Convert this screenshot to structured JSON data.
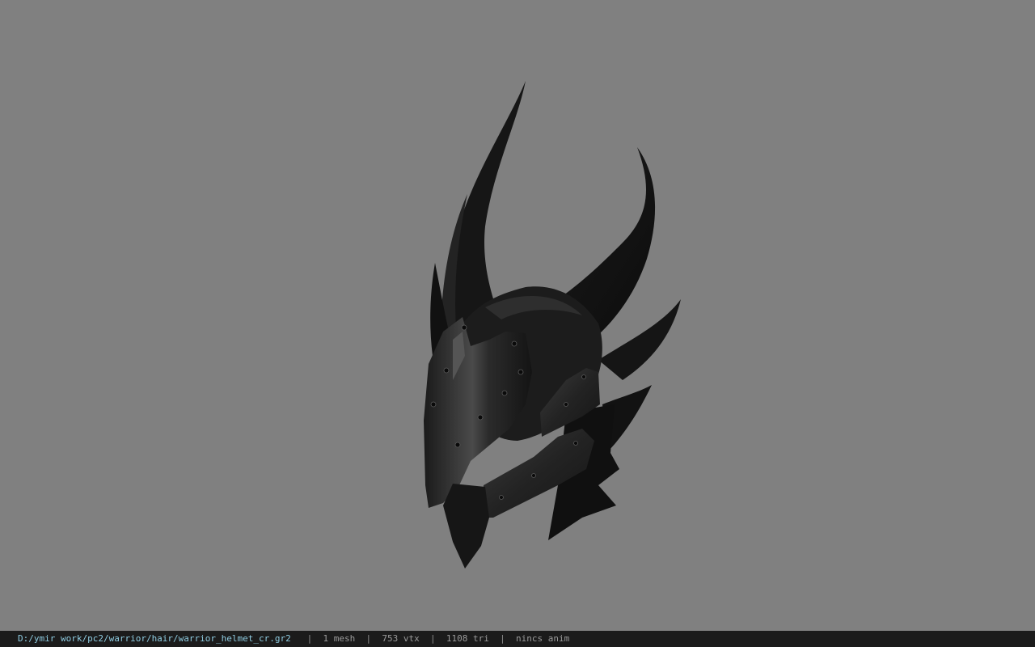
{
  "viewer": {
    "background_color": "#808080",
    "model_icon": "helmet-model"
  },
  "status_bar": {
    "file_path": "D:/ymir work/pc2/warrior/hair/warrior_helmet_cr.gr2",
    "mesh_count": "1 mesh",
    "vertex_count": "753 vtx",
    "triangle_count": "1108 tri",
    "animation": "nincs anim",
    "separator": "|",
    "path_color": "#8ecbe0"
  }
}
